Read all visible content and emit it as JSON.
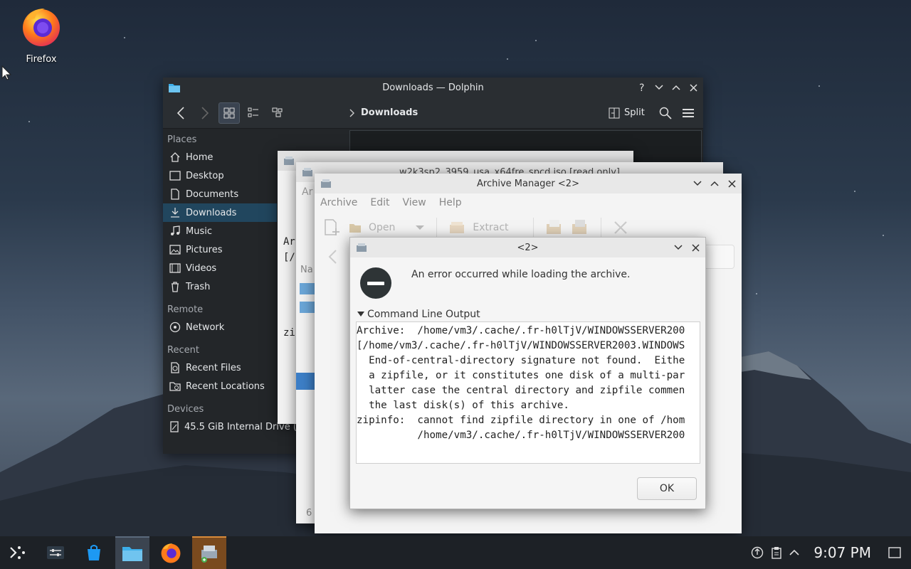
{
  "desktop": {
    "firefox_label": "Firefox"
  },
  "dolphin": {
    "title": "Downloads — Dolphin",
    "breadcrumb": "Downloads",
    "split_label": "Split",
    "places_header": "Places",
    "places": [
      "Home",
      "Desktop",
      "Documents",
      "Downloads",
      "Music",
      "Pictures",
      "Videos",
      "Trash"
    ],
    "remote_header": "Remote",
    "remote": [
      "Network"
    ],
    "recent_header": "Recent",
    "recent": [
      "Recent Files",
      "Recent Locations"
    ],
    "devices_header": "Devices",
    "devices": [
      "45.5 GiB Internal Drive (v"
    ]
  },
  "archive_back": {
    "title": "w2k3sp2_3959_usa_x64fre_spcd.iso [read only]",
    "text_ar": "Ar",
    "text_bracket": "[/",
    "text_na": "Na",
    "text_zi": "zi",
    "text_6": "6"
  },
  "archive_front": {
    "title": "Archive Manager <2>",
    "menu": [
      "Archive",
      "Edit",
      "View",
      "Help"
    ],
    "open_label": "Open",
    "extract_label": "Extract"
  },
  "dialog": {
    "title": "<2>",
    "message": "An error occurred while loading the archive.",
    "expander_label": "Command Line Output",
    "output_lines": [
      "Archive:  /home/vm3/.cache/.fr-h0lTjV/WINDOWSSERVER200",
      "[/home/vm3/.cache/.fr-h0lTjV/WINDOWSSERVER2003.WINDOWS",
      "  End-of-central-directory signature not found.  Eithe",
      "  a zipfile, or it constitutes one disk of a multi-par",
      "  latter case the central directory and zipfile commen",
      "  the last disk(s) of this archive.",
      "zipinfo:  cannot find zipfile directory in one of /hom",
      "          /home/vm3/.cache/.fr-h0lTjV/WINDOWSSERVER200"
    ],
    "ok_label": "OK"
  },
  "taskbar": {
    "clock": "9:07 PM"
  },
  "colors": {
    "selection": "#21465e",
    "dolphin_bg": "#232629",
    "taskbar_bg": "#1d2126"
  }
}
